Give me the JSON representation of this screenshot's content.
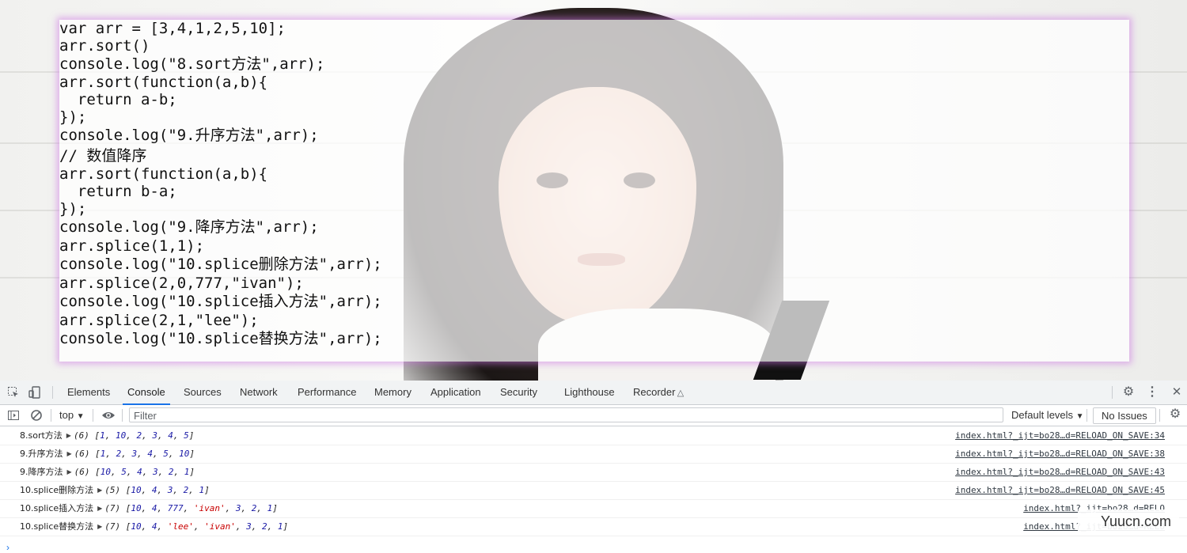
{
  "code_lines": [
    "var arr = [3,4,1,2,5,10];",
    "arr.sort()",
    "console.log(\"8.sort方法\",arr);",
    "arr.sort(function(a,b){",
    "  return a-b;",
    "});",
    "console.log(\"9.升序方法\",arr);",
    "// 数值降序",
    "arr.sort(function(a,b){",
    "  return b-a;",
    "});",
    "console.log(\"9.降序方法\",arr);",
    "arr.splice(1,1);",
    "console.log(\"10.splice删除方法\",arr);",
    "arr.splice(2,0,777,\"ivan\");",
    "console.log(\"10.splice插入方法\",arr);",
    "arr.splice(2,1,\"lee\");",
    "console.log(\"10.splice替换方法\",arr);"
  ],
  "devtools": {
    "tabs": [
      "Elements",
      "Console",
      "Sources",
      "Network",
      "Performance",
      "Memory",
      "Application",
      "Security",
      "Lighthouse",
      "Recorder"
    ],
    "active_tab": "Console",
    "toolbar": {
      "context": "top",
      "filter_placeholder": "Filter",
      "levels": "Default levels",
      "issues": "No Issues"
    }
  },
  "console": {
    "rows": [
      {
        "label": "8.sort方法",
        "count": "(6)",
        "items": [
          [
            "1",
            "n"
          ],
          [
            "10",
            "n"
          ],
          [
            "2",
            "n"
          ],
          [
            "3",
            "n"
          ],
          [
            "4",
            "n"
          ],
          [
            "5",
            "n"
          ]
        ],
        "source": "index.html?_ijt=bo28…d=RELOAD_ON_SAVE:34"
      },
      {
        "label": "9.升序方法",
        "count": "(6)",
        "items": [
          [
            "1",
            "n"
          ],
          [
            "2",
            "n"
          ],
          [
            "3",
            "n"
          ],
          [
            "4",
            "n"
          ],
          [
            "5",
            "n"
          ],
          [
            "10",
            "n"
          ]
        ],
        "source": "index.html?_ijt=bo28…d=RELOAD_ON_SAVE:38"
      },
      {
        "label": "9.降序方法",
        "count": "(6)",
        "items": [
          [
            "10",
            "n"
          ],
          [
            "5",
            "n"
          ],
          [
            "4",
            "n"
          ],
          [
            "3",
            "n"
          ],
          [
            "2",
            "n"
          ],
          [
            "1",
            "n"
          ]
        ],
        "source": "index.html?_ijt=bo28…d=RELOAD_ON_SAVE:43"
      },
      {
        "label": "10.splice删除方法",
        "count": "(5)",
        "items": [
          [
            "10",
            "n"
          ],
          [
            "4",
            "n"
          ],
          [
            "3",
            "n"
          ],
          [
            "2",
            "n"
          ],
          [
            "1",
            "n"
          ]
        ],
        "source": "index.html?_ijt=bo28…d=RELOAD_ON_SAVE:45"
      },
      {
        "label": "10.splice插入方法",
        "count": "(7)",
        "items": [
          [
            "10",
            "n"
          ],
          [
            "4",
            "n"
          ],
          [
            "777",
            "n"
          ],
          [
            "'ivan'",
            "s"
          ],
          [
            "3",
            "n"
          ],
          [
            "2",
            "n"
          ],
          [
            "1",
            "n"
          ]
        ],
        "source": "index.html?_ijt=bo28…d=RELO"
      },
      {
        "label": "10.splice替换方法",
        "count": "(7)",
        "items": [
          [
            "10",
            "n"
          ],
          [
            "4",
            "n"
          ],
          [
            "'lee'",
            "s"
          ],
          [
            "'ivan'",
            "s"
          ],
          [
            "3",
            "n"
          ],
          [
            "2",
            "n"
          ],
          [
            "1",
            "n"
          ]
        ],
        "source": "index.html?_ijt=bo28…d=RELO"
      }
    ]
  },
  "watermark": "Yuucn.com",
  "colors": {
    "panel_glow": "#cc76e2",
    "active_tab_underline": "#1a73e8",
    "number": "#1a1aa6",
    "string": "#c80000"
  }
}
